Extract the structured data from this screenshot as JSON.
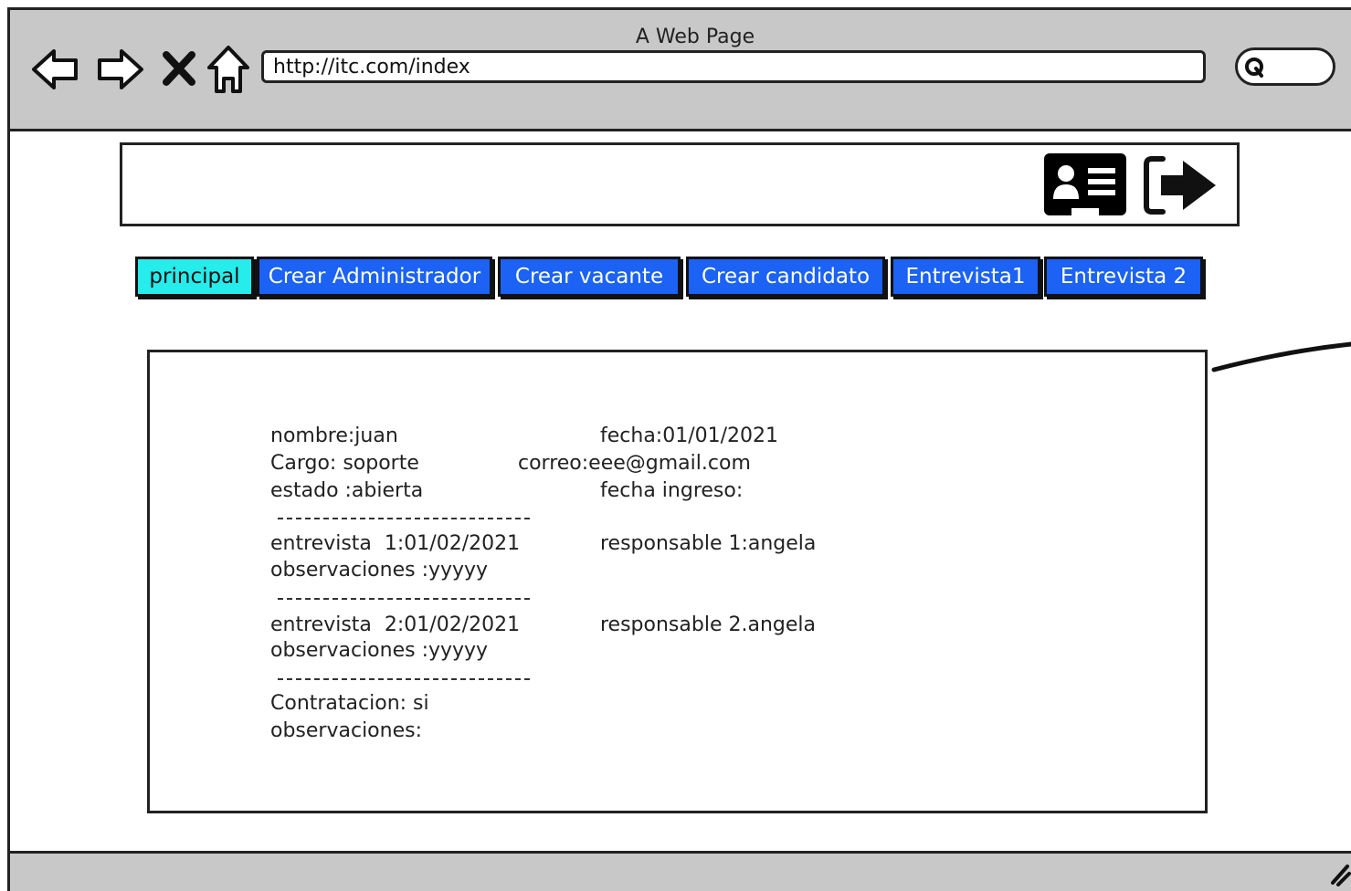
{
  "window": {
    "title": "A Web Page"
  },
  "address_bar": {
    "url": "http://itc.com/index"
  },
  "tabs": [
    {
      "label": "principal",
      "active": true
    },
    {
      "label": "Crear Administrador"
    },
    {
      "label": "Crear vacante"
    },
    {
      "label": "Crear candidato"
    },
    {
      "label": "Entrevista1"
    },
    {
      "label": "Entrevista 2"
    }
  ],
  "details": {
    "nombre": "nombre:juan",
    "fecha": "fecha:01/01/2021",
    "cargo": "Cargo: soporte",
    "correo": "correo:eee@gmail.com",
    "estado": "estado :abierta",
    "fecha_ingreso": "fecha ingreso:",
    "entrevista1": "entrevista  1:01/02/2021",
    "responsable1": "responsable 1:angela",
    "observaciones1": "observaciones :yyyyy",
    "entrevista2": "entrevista  2:01/02/2021",
    "responsable2": "responsable 2.angela",
    "observaciones2": "observaciones :yyyyy",
    "contratacion": "Contratacion: si",
    "observaciones_final": "observaciones:"
  },
  "colors": {
    "tab_active": "#26ecec",
    "tab_default": "#1b62f5",
    "chrome": "#c8c8c8"
  },
  "icons": [
    "back-icon",
    "forward-icon",
    "close-icon",
    "home-icon",
    "search-icon",
    "profile-card-icon",
    "logout-icon",
    "resize-grip-icon"
  ]
}
